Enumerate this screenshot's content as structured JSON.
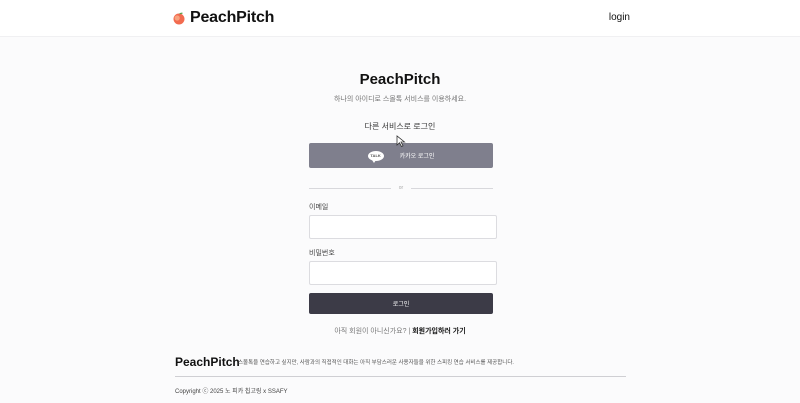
{
  "header": {
    "brand": "PeachPitch",
    "logo_icon": "peach-icon",
    "login_link": "login"
  },
  "main": {
    "title": "PeachPitch",
    "subtitle": "하나의 아이디로 스몰톡 서비스를 이용하세요.",
    "social_label": "다른 서비스로 로그인",
    "kakao": {
      "bubble_text": "TALK",
      "label": "카카오 로그인",
      "color": "#7f7f8d"
    },
    "divider_text": "or",
    "email_label": "이메일",
    "password_label": "비밀번호",
    "submit_label": "로그인",
    "signup_prompt": "아직 회원이 아니신가요? |",
    "signup_link": "회원가입하러 가기"
  },
  "footer": {
    "brand": "PeachPitch",
    "description": "스몰톡을 연습하고 싶지만, 사람과의 직접적인 대화는 아직 부담스러운 사용자들을 위한 스피킹 연습 서비스를 제공합니다.",
    "copyright": "Copyright ⓒ 2025 노 피카 칩고링 x SSAFY"
  },
  "colors": {
    "primary_button": "#3c3b47",
    "background": "#fbfbfc"
  }
}
